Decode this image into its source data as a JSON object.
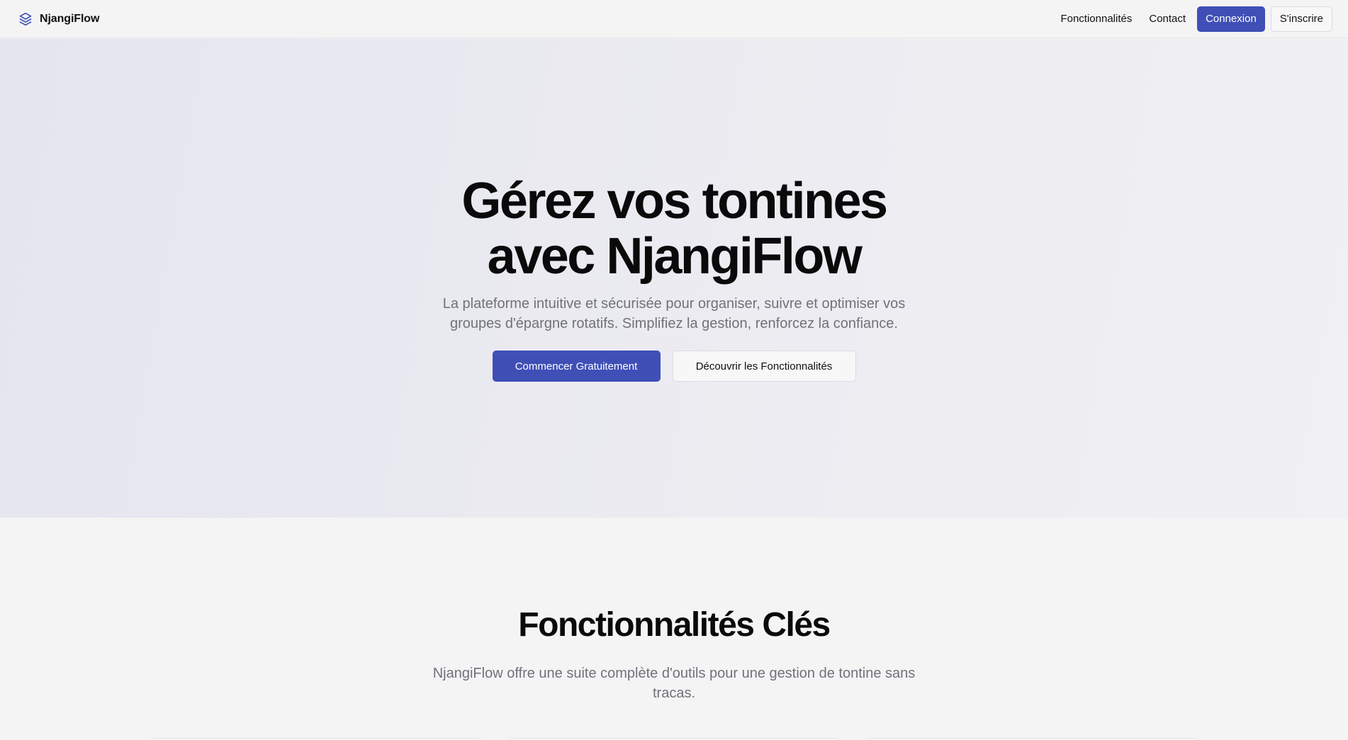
{
  "header": {
    "brand": "NjangiFlow",
    "nav": {
      "features": "Fonctionnalités",
      "contact": "Contact"
    },
    "login_label": "Connexion",
    "signup_label": "S'inscrire"
  },
  "hero": {
    "title_line1": "Gérez vos tontines",
    "title_line2": "avec NjangiFlow",
    "subtitle": "La plateforme intuitive et sécurisée pour organiser, suivre et optimiser vos groupes d'épargne rotatifs. Simplifiez la gestion, renforcez la confiance.",
    "primary_cta": "Commencer Gratuitement",
    "secondary_cta": "Découvrir les Fonctionnalités"
  },
  "features": {
    "title": "Fonctionnalités Clés",
    "subtitle": "NjangiFlow offre une suite complète d'outils pour une gestion de tontine sans tracas."
  },
  "colors": {
    "accent": "#3f4fb6",
    "muted_text": "#71717a",
    "background": "#f4f4f5"
  },
  "icons": {
    "brand": "layers-icon"
  }
}
